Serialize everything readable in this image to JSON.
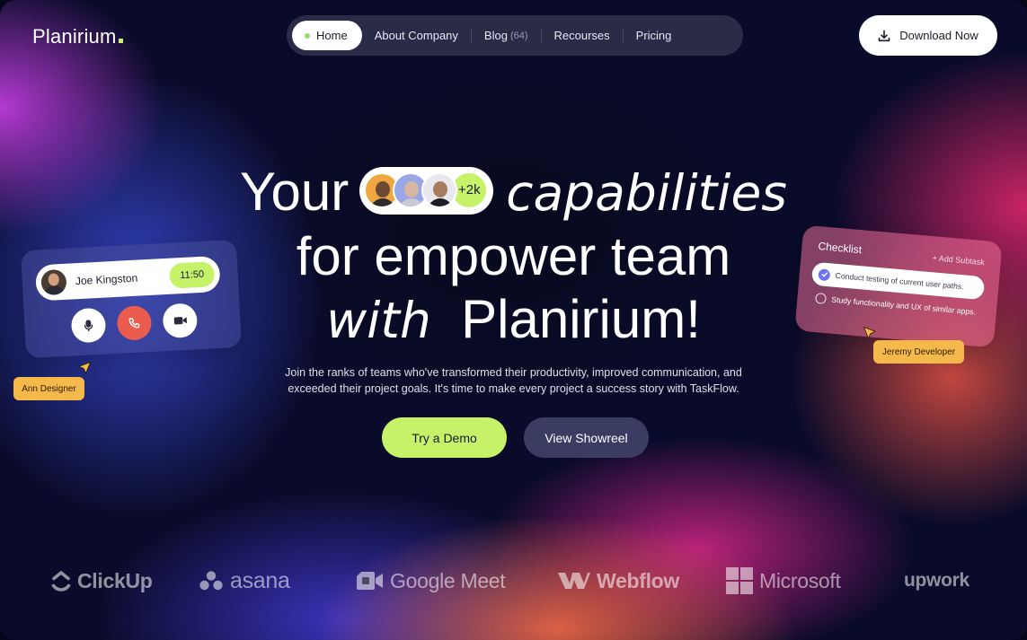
{
  "header": {
    "logo": "Planirium",
    "nav": [
      {
        "label": "Home",
        "active": true
      },
      {
        "label": "About Company"
      },
      {
        "label": "Blog",
        "count": "(64)"
      },
      {
        "label": "Recourses"
      },
      {
        "label": "Pricing"
      }
    ],
    "download_label": "Download Now"
  },
  "hero": {
    "line1_pre": "Your",
    "avatar_more": "+2k",
    "line1_post": "capabilities",
    "line2": "for empower team",
    "line3_italic": "with",
    "line3_main": "Planirium!",
    "subtitle_line1": "Join the ranks of teams who've transformed their productivity, improved communication, and",
    "subtitle_line2": "exceeded their project goals. It's time to make every project a success story with TaskFlow.",
    "primary_cta": "Try a Demo",
    "secondary_cta": "View Showreel"
  },
  "call_card": {
    "caller_name": "Joe Kingston",
    "time": "11:50",
    "cursor_tag": "Ann Designer"
  },
  "checklist": {
    "title": "Checklist",
    "add_subtask": "+ Add Subtask",
    "tasks": [
      {
        "text": "Conduct testing of current user paths.",
        "done": true
      },
      {
        "text": "Study functionality and UX of similar apps.",
        "done": false
      }
    ],
    "cursor_tag": "Jeremy Developer"
  },
  "brands": [
    "ClickUp",
    "asana",
    "Google Meet",
    "Webflow",
    "Microsoft",
    "upwork"
  ],
  "colors": {
    "accent_lime": "#c6f26a",
    "tag_yellow": "#f4b94a",
    "end_call_red": "#ec5c4e",
    "checkbox_purple": "#6f73f0"
  }
}
